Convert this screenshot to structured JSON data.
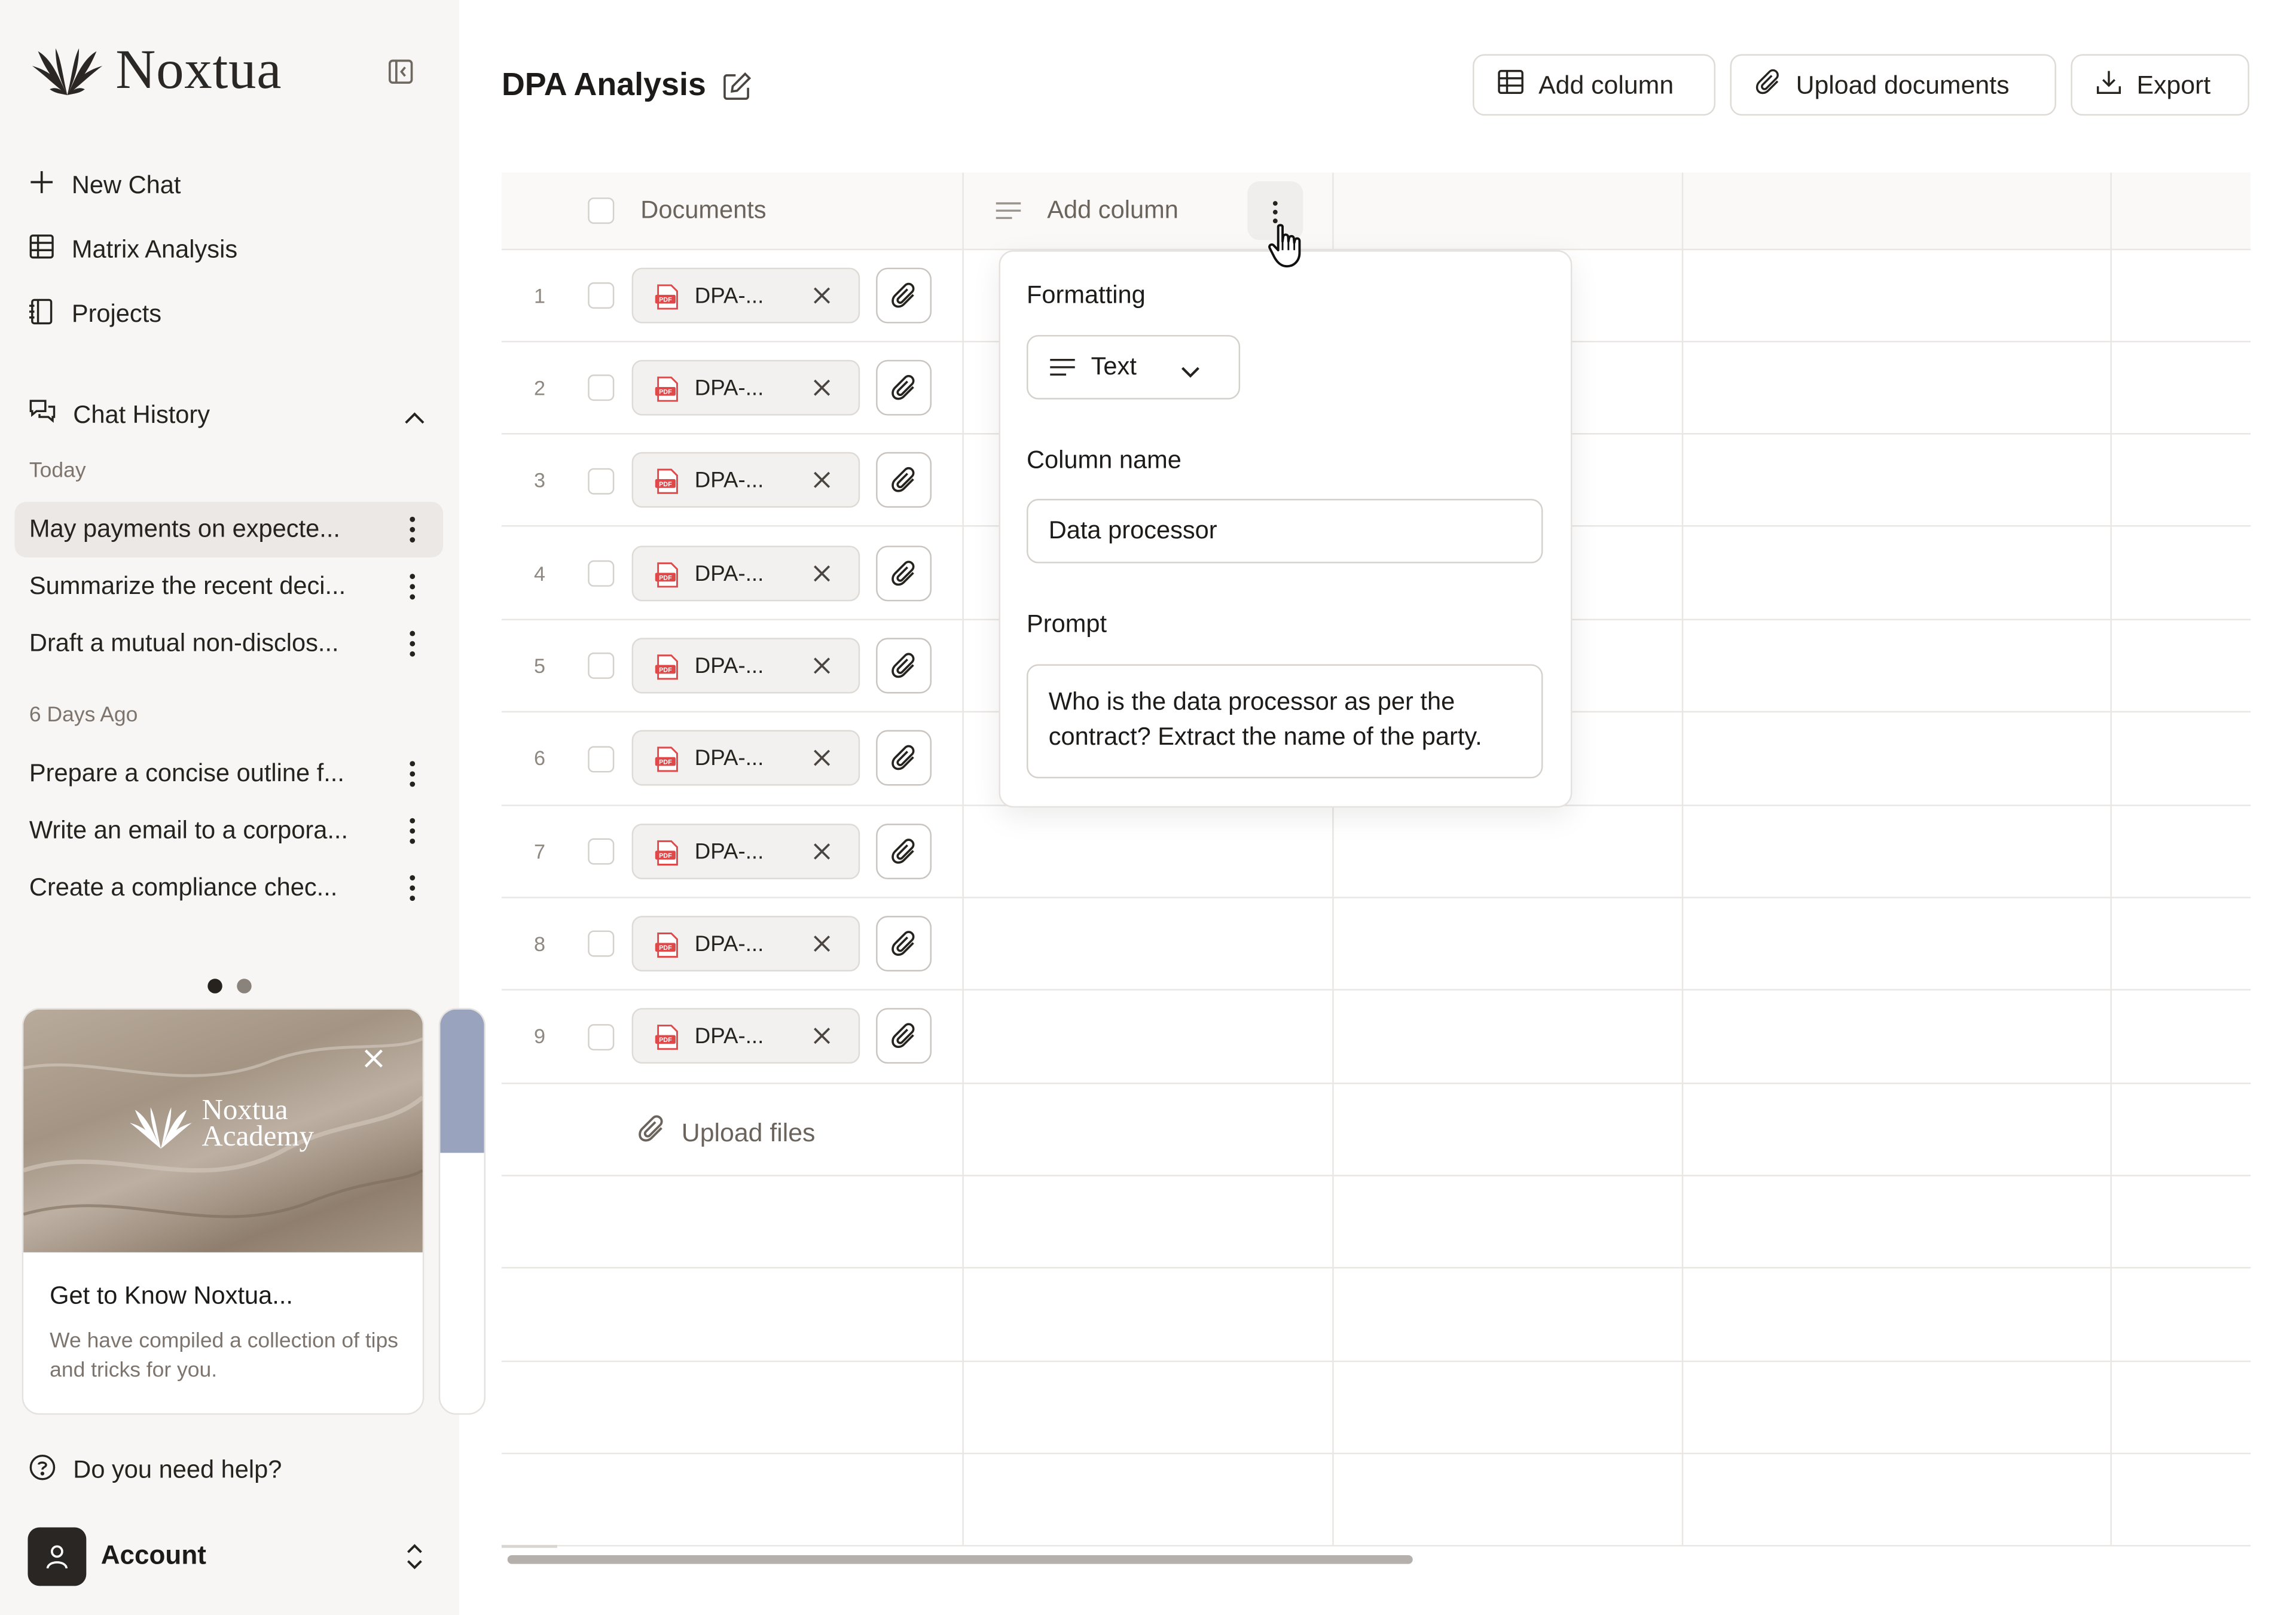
{
  "app": {
    "name": "Noxtua"
  },
  "sidebar": {
    "nav": [
      {
        "label": "New Chat",
        "icon": "plus-icon"
      },
      {
        "label": "Matrix Analysis",
        "icon": "grid-icon"
      },
      {
        "label": "Projects",
        "icon": "notebook-icon"
      }
    ],
    "chat_history_label": "Chat History",
    "groups": [
      {
        "label": "Today",
        "items": [
          "May payments on expecte...",
          "Summarize the recent deci...",
          "Draft a mutual non-disclos..."
        ]
      },
      {
        "label": "6 Days Ago",
        "items": [
          "Prepare a concise outline f...",
          "Write an email to a corpora...",
          "Create a compliance chec..."
        ]
      }
    ],
    "promo": {
      "brand_line1": "Noxtua",
      "brand_line2": "Academy",
      "title": "Get to Know Noxtua...",
      "body": "We have compiled a collection of tips and tricks for you.",
      "carousel_total": 2,
      "carousel_active": 1
    },
    "help_label": "Do you need help?",
    "account_label": "Account"
  },
  "header": {
    "title": "DPA Analysis",
    "buttons": {
      "add_column": "Add column",
      "upload_documents": "Upload documents",
      "export": "Export"
    }
  },
  "table": {
    "documents_header": "Documents",
    "column_header": "Add column",
    "rows": [
      {
        "num": "1",
        "file": "DPA-..."
      },
      {
        "num": "2",
        "file": "DPA-..."
      },
      {
        "num": "3",
        "file": "DPA-..."
      },
      {
        "num": "4",
        "file": "DPA-..."
      },
      {
        "num": "5",
        "file": "DPA-..."
      },
      {
        "num": "6",
        "file": "DPA-..."
      },
      {
        "num": "7",
        "file": "DPA-..."
      },
      {
        "num": "8",
        "file": "DPA-..."
      },
      {
        "num": "9",
        "file": "DPA-..."
      }
    ],
    "upload_files_label": "Upload files"
  },
  "column_popover": {
    "formatting_label": "Formatting",
    "format_value": "Text",
    "column_name_label": "Column name",
    "column_name_value": "Data processor",
    "prompt_label": "Prompt",
    "prompt_value": "Who is the data processor as per the contract? Extract the name of the party."
  },
  "colors": {
    "pdf_red": "#e0494a",
    "sidebar_bg": "#f7f6f5",
    "active_item_bg": "#ebe8e5",
    "border": "#dedad6"
  }
}
